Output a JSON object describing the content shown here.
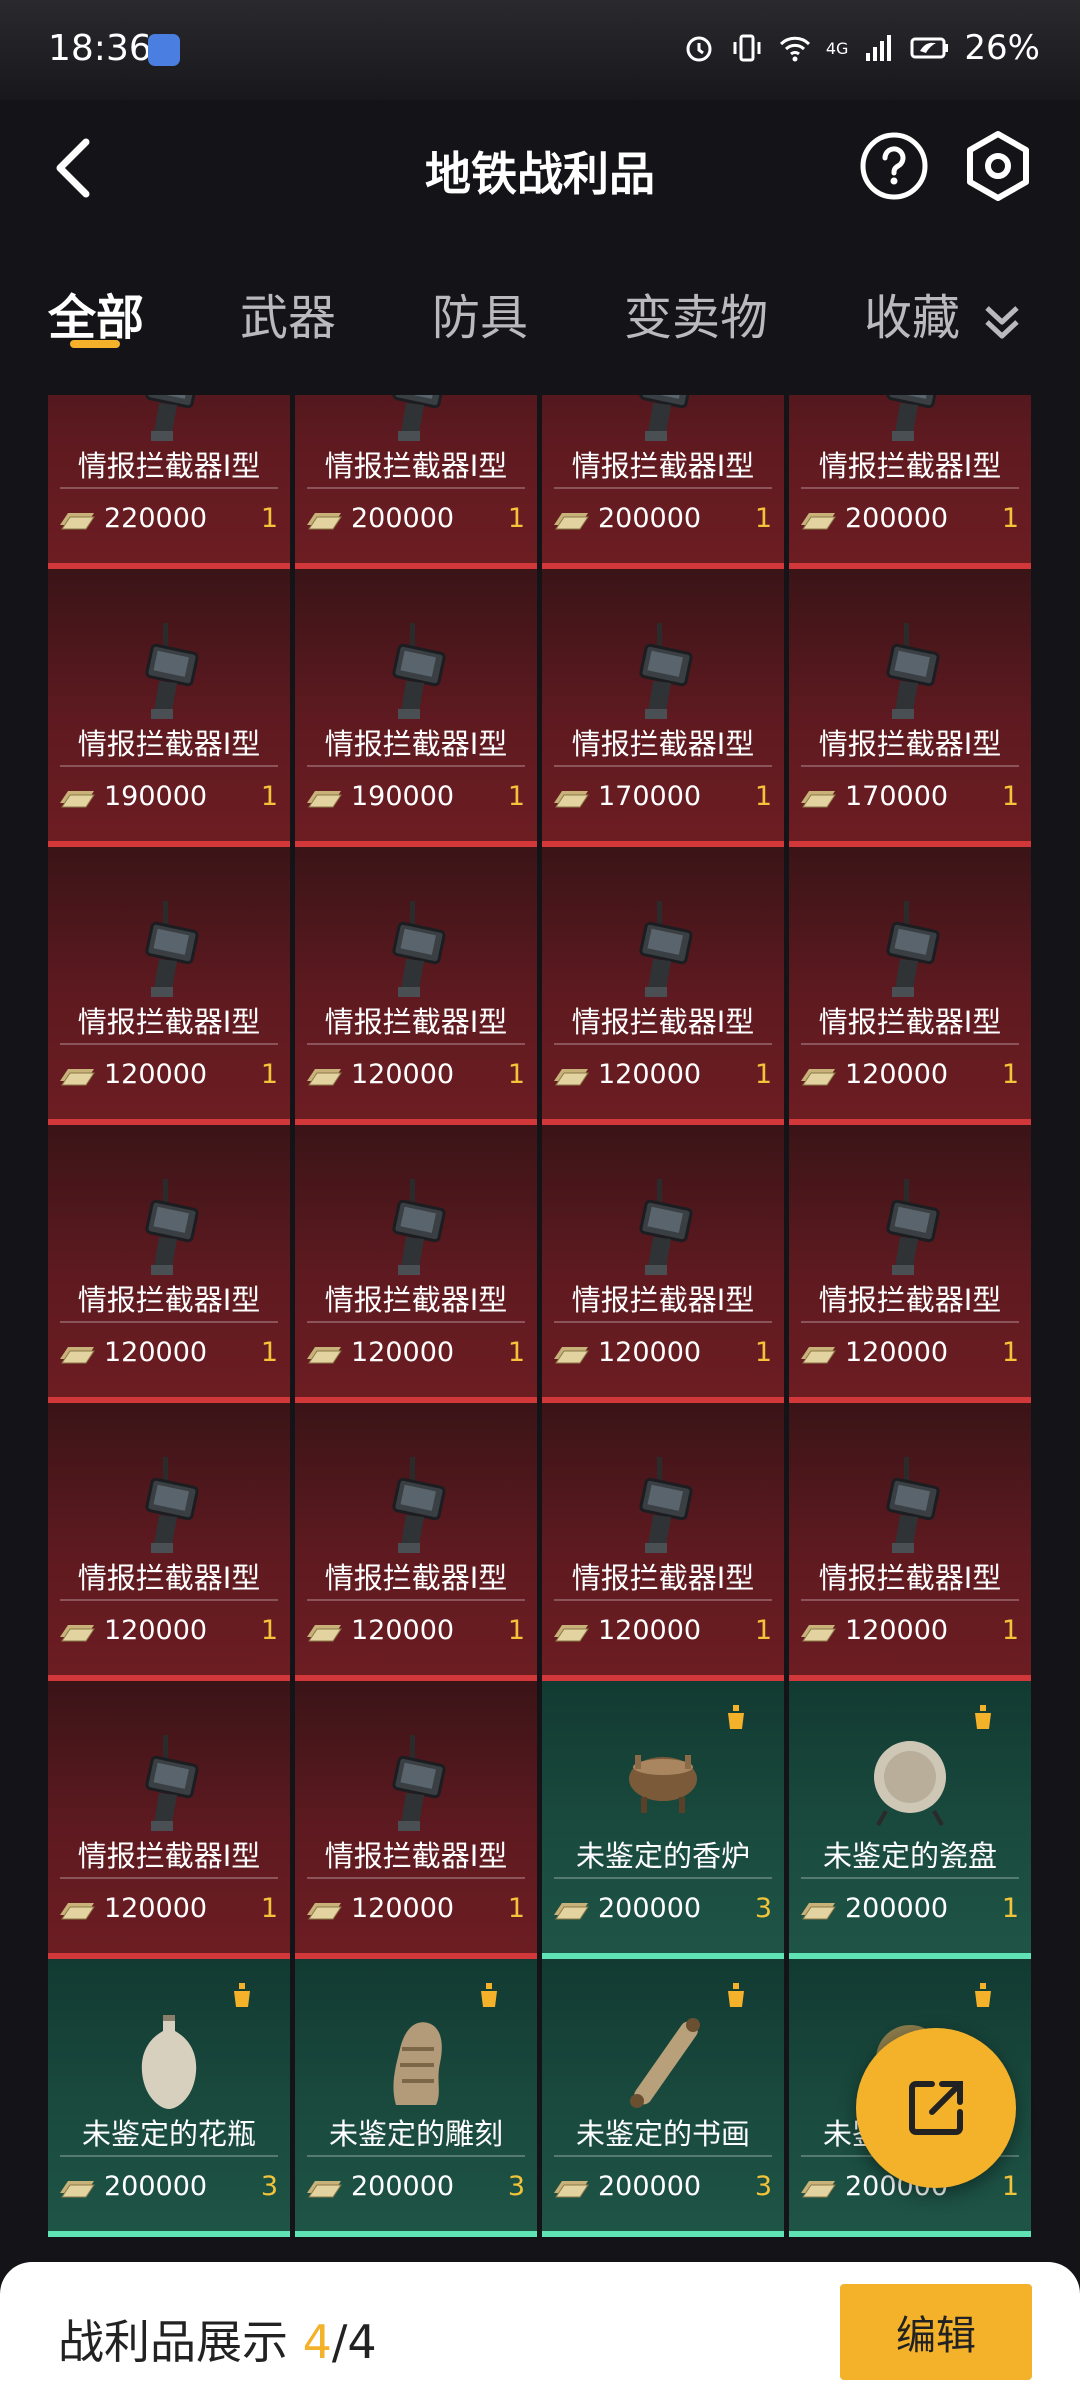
{
  "status_bar": {
    "time": "18:36",
    "network": "4G",
    "battery": "26%"
  },
  "header": {
    "title": "地铁战利品"
  },
  "tabs": [
    {
      "label": "全部",
      "active": true
    },
    {
      "label": "武器",
      "active": false
    },
    {
      "label": "防具",
      "active": false
    },
    {
      "label": "变卖物",
      "active": false
    },
    {
      "label": "收藏",
      "active": false
    }
  ],
  "colors": {
    "accent": "#f3b22a",
    "red_rarity": "#d2383a",
    "green_rarity": "#5fe2b4"
  },
  "items": [
    {
      "name": "情报拦截器I型",
      "price": "220000",
      "qty": "1",
      "rarity": "red",
      "icon": "interceptor-device-icon"
    },
    {
      "name": "情报拦截器I型",
      "price": "200000",
      "qty": "1",
      "rarity": "red",
      "icon": "interceptor-device-icon"
    },
    {
      "name": "情报拦截器I型",
      "price": "200000",
      "qty": "1",
      "rarity": "red",
      "icon": "interceptor-device-icon"
    },
    {
      "name": "情报拦截器I型",
      "price": "200000",
      "qty": "1",
      "rarity": "red",
      "icon": "interceptor-device-icon"
    },
    {
      "name": "情报拦截器I型",
      "price": "190000",
      "qty": "1",
      "rarity": "red",
      "icon": "interceptor-device-icon"
    },
    {
      "name": "情报拦截器I型",
      "price": "190000",
      "qty": "1",
      "rarity": "red",
      "icon": "interceptor-device-icon"
    },
    {
      "name": "情报拦截器I型",
      "price": "170000",
      "qty": "1",
      "rarity": "red",
      "icon": "interceptor-device-icon"
    },
    {
      "name": "情报拦截器I型",
      "price": "170000",
      "qty": "1",
      "rarity": "red",
      "icon": "interceptor-device-icon"
    },
    {
      "name": "情报拦截器I型",
      "price": "120000",
      "qty": "1",
      "rarity": "red",
      "icon": "interceptor-device-icon"
    },
    {
      "name": "情报拦截器I型",
      "price": "120000",
      "qty": "1",
      "rarity": "red",
      "icon": "interceptor-device-icon"
    },
    {
      "name": "情报拦截器I型",
      "price": "120000",
      "qty": "1",
      "rarity": "red",
      "icon": "interceptor-device-icon"
    },
    {
      "name": "情报拦截器I型",
      "price": "120000",
      "qty": "1",
      "rarity": "red",
      "icon": "interceptor-device-icon"
    },
    {
      "name": "情报拦截器I型",
      "price": "120000",
      "qty": "1",
      "rarity": "red",
      "icon": "interceptor-device-icon"
    },
    {
      "name": "情报拦截器I型",
      "price": "120000",
      "qty": "1",
      "rarity": "red",
      "icon": "interceptor-device-icon"
    },
    {
      "name": "情报拦截器I型",
      "price": "120000",
      "qty": "1",
      "rarity": "red",
      "icon": "interceptor-device-icon"
    },
    {
      "name": "情报拦截器I型",
      "price": "120000",
      "qty": "1",
      "rarity": "red",
      "icon": "interceptor-device-icon"
    },
    {
      "name": "情报拦截器I型",
      "price": "120000",
      "qty": "1",
      "rarity": "red",
      "icon": "interceptor-device-icon"
    },
    {
      "name": "情报拦截器I型",
      "price": "120000",
      "qty": "1",
      "rarity": "red",
      "icon": "interceptor-device-icon"
    },
    {
      "name": "情报拦截器I型",
      "price": "120000",
      "qty": "1",
      "rarity": "red",
      "icon": "interceptor-device-icon"
    },
    {
      "name": "情报拦截器I型",
      "price": "120000",
      "qty": "1",
      "rarity": "red",
      "icon": "interceptor-device-icon"
    },
    {
      "name": "情报拦截器I型",
      "price": "120000",
      "qty": "1",
      "rarity": "red",
      "icon": "interceptor-device-icon"
    },
    {
      "name": "情报拦截器I型",
      "price": "120000",
      "qty": "1",
      "rarity": "red",
      "icon": "interceptor-device-icon"
    },
    {
      "name": "未鉴定的香炉",
      "price": "200000",
      "qty": "3",
      "rarity": "green",
      "icon": "incense-burner-icon"
    },
    {
      "name": "未鉴定的瓷盘",
      "price": "200000",
      "qty": "1",
      "rarity": "green",
      "icon": "porcelain-plate-icon"
    },
    {
      "name": "未鉴定的花瓶",
      "price": "200000",
      "qty": "3",
      "rarity": "green",
      "icon": "vase-icon"
    },
    {
      "name": "未鉴定的雕刻",
      "price": "200000",
      "qty": "3",
      "rarity": "green",
      "icon": "carving-icon"
    },
    {
      "name": "未鉴定的书画",
      "price": "200000",
      "qty": "3",
      "rarity": "green",
      "icon": "scroll-painting-icon"
    },
    {
      "name": "未鉴定的铜镜",
      "price": "200000",
      "qty": "1",
      "rarity": "green",
      "icon": "bronze-mirror-icon"
    }
  ],
  "bottom_bar": {
    "label": "战利品展示",
    "count": "4",
    "sep": "/",
    "total": "4",
    "edit_label": "编辑"
  }
}
